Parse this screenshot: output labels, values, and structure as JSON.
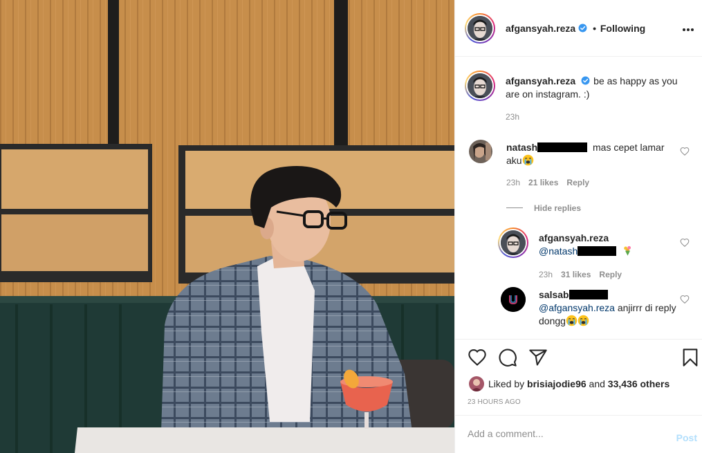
{
  "post": {
    "author": "afgansyah.reza",
    "follow_status": "Following",
    "separator": "•"
  },
  "caption": {
    "username": "afgansyah.reza",
    "text": "be as happy as you are on instagram. :)",
    "time": "23h"
  },
  "comments": [
    {
      "username_prefix": "natash",
      "text": "mas cepet lamar aku",
      "emoji": "crying-face",
      "time": "23h",
      "likes": "21 likes",
      "reply_label": "Reply"
    }
  ],
  "hide_replies_label": "Hide replies",
  "replies": [
    {
      "username": "afgansyah.reza",
      "mention_prefix": "@natash",
      "emoji": "bouquet",
      "time": "23h",
      "likes": "31 likes",
      "reply_label": "Reply"
    },
    {
      "username_prefix": "salsab",
      "mention": "@afgansyah.reza",
      "text": "anjirrr di reply dongg",
      "emoji": "crying-face"
    }
  ],
  "likes": {
    "prefix": "Liked by",
    "liker": "brisiajodie96",
    "connector": "and",
    "others": "33,436 others"
  },
  "post_time": "23 HOURS AGO",
  "add_comment": {
    "placeholder": "Add a comment...",
    "post_label": "Post"
  },
  "icons": [
    "heart-icon",
    "comment-icon",
    "share-icon",
    "bookmark-icon",
    "more-icon",
    "verified-badge-icon"
  ],
  "colors": {
    "verified": "#3897f0",
    "text": "#262626",
    "secondary": "#8e8e8e",
    "post_disabled": "#b2dffc",
    "mention": "#00376b"
  }
}
